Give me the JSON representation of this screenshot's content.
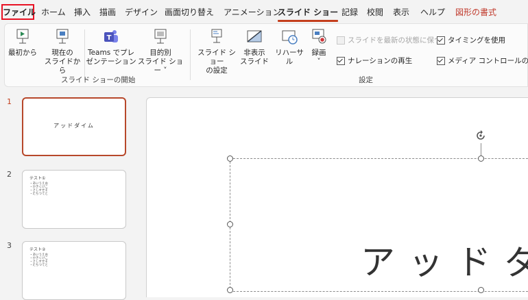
{
  "menu": {
    "tabs": [
      {
        "label": "ファイル"
      },
      {
        "label": "ホーム"
      },
      {
        "label": "挿入"
      },
      {
        "label": "描画"
      },
      {
        "label": "デザイン"
      },
      {
        "label": "画面切り替え"
      },
      {
        "label": "アニメーション"
      },
      {
        "label": "スライド ショー"
      },
      {
        "label": "記録"
      },
      {
        "label": "校閲"
      },
      {
        "label": "表示"
      },
      {
        "label": "ヘルプ"
      },
      {
        "label": "図形の書式"
      }
    ],
    "active_tab": "スライド ショー"
  },
  "ribbon": {
    "start_group": {
      "label": "スライド ショーの開始",
      "buttons": [
        {
          "line1": "最初から",
          "line2": "",
          "icon": "play-from-start-icon"
        },
        {
          "line1": "現在の",
          "line2": "スライドから",
          "icon": "play-from-current-icon"
        },
        {
          "line1": "Teams でプレ",
          "line2": "ゼンテーション",
          "icon": "teams-icon"
        },
        {
          "line1": "目的別",
          "line2": "スライド ショー ˅",
          "icon": "custom-show-icon"
        }
      ]
    },
    "setup_group": {
      "label": "設定",
      "buttons": [
        {
          "line1": "スライド ショー",
          "line2": "の設定",
          "icon": "setup-show-icon"
        },
        {
          "line1": "非表示",
          "line2": "スライド",
          "icon": "hide-slide-icon"
        },
        {
          "line1": "リハーサル",
          "line2": "",
          "icon": "rehearse-timings-icon"
        },
        {
          "line1": "録画",
          "line2": "˅",
          "icon": "record-icon"
        }
      ],
      "checkboxes": [
        {
          "label": "スライドを最新の状態に保つ",
          "checked": false,
          "disabled": true
        },
        {
          "label": "タイミングを使用",
          "checked": true,
          "disabled": false
        },
        {
          "label": "ナレーションの再生",
          "checked": true,
          "disabled": false
        },
        {
          "label": "メディア コントロールの表示",
          "checked": true,
          "disabled": false
        }
      ]
    }
  },
  "slides": [
    {
      "number": "1",
      "title": "アッドダイム",
      "bullets": []
    },
    {
      "number": "2",
      "title": "テスト①",
      "bullets": [
        "・あいうえお",
        "・かきくけこ",
        "・さしすせそ",
        "・たちつてと"
      ]
    },
    {
      "number": "3",
      "title": "テスト②",
      "bullets": [
        "・あいうえお",
        "・かきくけこ",
        "・さしすせそ",
        "・たちつてと"
      ]
    }
  ],
  "canvas": {
    "title_text": "アッドダ"
  },
  "colors": {
    "accent": "#c43e1c",
    "file_highlight": "#e81123",
    "contextual_tab": "#c0392b"
  }
}
